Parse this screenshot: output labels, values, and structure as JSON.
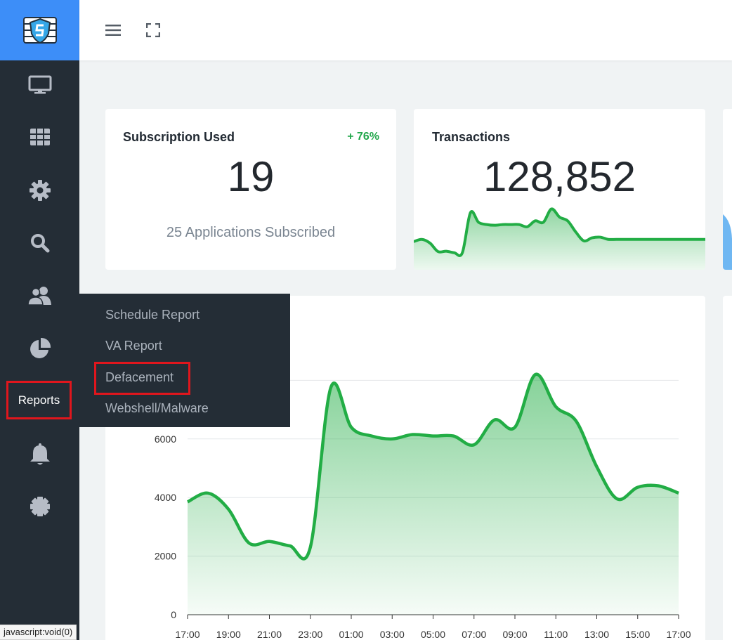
{
  "app": {
    "logo_icon": "shield-firewall-logo-icon"
  },
  "topbar": {
    "menu_icon": "hamburger-menu-icon",
    "fullscreen_icon": "fullscreen-icon"
  },
  "sidebar": {
    "items": [
      {
        "icon": "monitor-icon"
      },
      {
        "icon": "grid-icon"
      },
      {
        "icon": "gear-icon"
      },
      {
        "icon": "search-icon"
      },
      {
        "icon": "users-icon"
      },
      {
        "icon": "pie-chart-icon"
      },
      {
        "label": "Reports"
      },
      {
        "icon": "bell-icon"
      },
      {
        "icon": "badge-gear-icon"
      }
    ]
  },
  "reports_menu": {
    "items": [
      "Schedule Report",
      "VA Report",
      "Defacement",
      "Webshell/Malware"
    ],
    "highlighted": "Defacement"
  },
  "cards": {
    "subscription": {
      "title": "Subscription Used",
      "badge": "+ 76%",
      "value": "19",
      "subtitle": "25 Applications Subscribed"
    },
    "transactions": {
      "title": "Transactions",
      "value": "128,852"
    }
  },
  "status_bar": {
    "text": "javascript:void(0)"
  },
  "colors": {
    "accent": "#3d8ef8",
    "sidebar": "#242d36",
    "line": "#22ad45",
    "highlight": "#e0161d",
    "positive": "#22a74b"
  },
  "chart_data": [
    {
      "type": "area",
      "title": "",
      "sparkline_of": "Transactions",
      "x": [
        0,
        1,
        2,
        3,
        4,
        5,
        6,
        7,
        8,
        9,
        10,
        11,
        12,
        13,
        14,
        15,
        16,
        17,
        18,
        19,
        20,
        21,
        22,
        23,
        24,
        25,
        26,
        27,
        28,
        29,
        30,
        31,
        32,
        33,
        34,
        35,
        36
      ],
      "values": [
        3800,
        4100,
        3600,
        2450,
        2500,
        2300,
        2300,
        7700,
        6400,
        6100,
        6000,
        6100,
        6100,
        6100,
        5800,
        6600,
        6400,
        8200,
        7100,
        6600,
        5100,
        3900,
        4300,
        4400,
        4100,
        4100,
        4100,
        4100,
        4100,
        4100,
        4100,
        4100,
        4100,
        4100,
        4100,
        4100,
        4100
      ],
      "ylim": [
        0,
        9000
      ]
    },
    {
      "type": "area",
      "title": "",
      "x": [
        "17:00",
        "19:00",
        "21:00",
        "23:00",
        "01:00",
        "03:00",
        "05:00",
        "07:00",
        "09:00",
        "11:00",
        "13:00",
        "15:00",
        "17:00"
      ],
      "points": [
        {
          "h": 0,
          "v": 3850
        },
        {
          "h": 1,
          "v": 4150
        },
        {
          "h": 2,
          "v": 3600
        },
        {
          "h": 3,
          "v": 2450
        },
        {
          "h": 4,
          "v": 2500
        },
        {
          "h": 5,
          "v": 2350
        },
        {
          "h": 6,
          "v": 2300
        },
        {
          "h": 7,
          "v": 7750
        },
        {
          "h": 8,
          "v": 6400
        },
        {
          "h": 9,
          "v": 6100
        },
        {
          "h": 10,
          "v": 6000
        },
        {
          "h": 11,
          "v": 6150
        },
        {
          "h": 12,
          "v": 6100
        },
        {
          "h": 13,
          "v": 6100
        },
        {
          "h": 14,
          "v": 5800
        },
        {
          "h": 15,
          "v": 6650
        },
        {
          "h": 16,
          "v": 6400
        },
        {
          "h": 17,
          "v": 8200
        },
        {
          "h": 18,
          "v": 7100
        },
        {
          "h": 19,
          "v": 6600
        },
        {
          "h": 20,
          "v": 5050
        },
        {
          "h": 21,
          "v": 3950
        },
        {
          "h": 22,
          "v": 4350
        },
        {
          "h": 23,
          "v": 4400
        },
        {
          "h": 24,
          "v": 4150
        }
      ],
      "y_ticks": [
        "0",
        "2000",
        "4000",
        "6000"
      ],
      "ylim": [
        0,
        10000
      ],
      "grid": true
    }
  ]
}
